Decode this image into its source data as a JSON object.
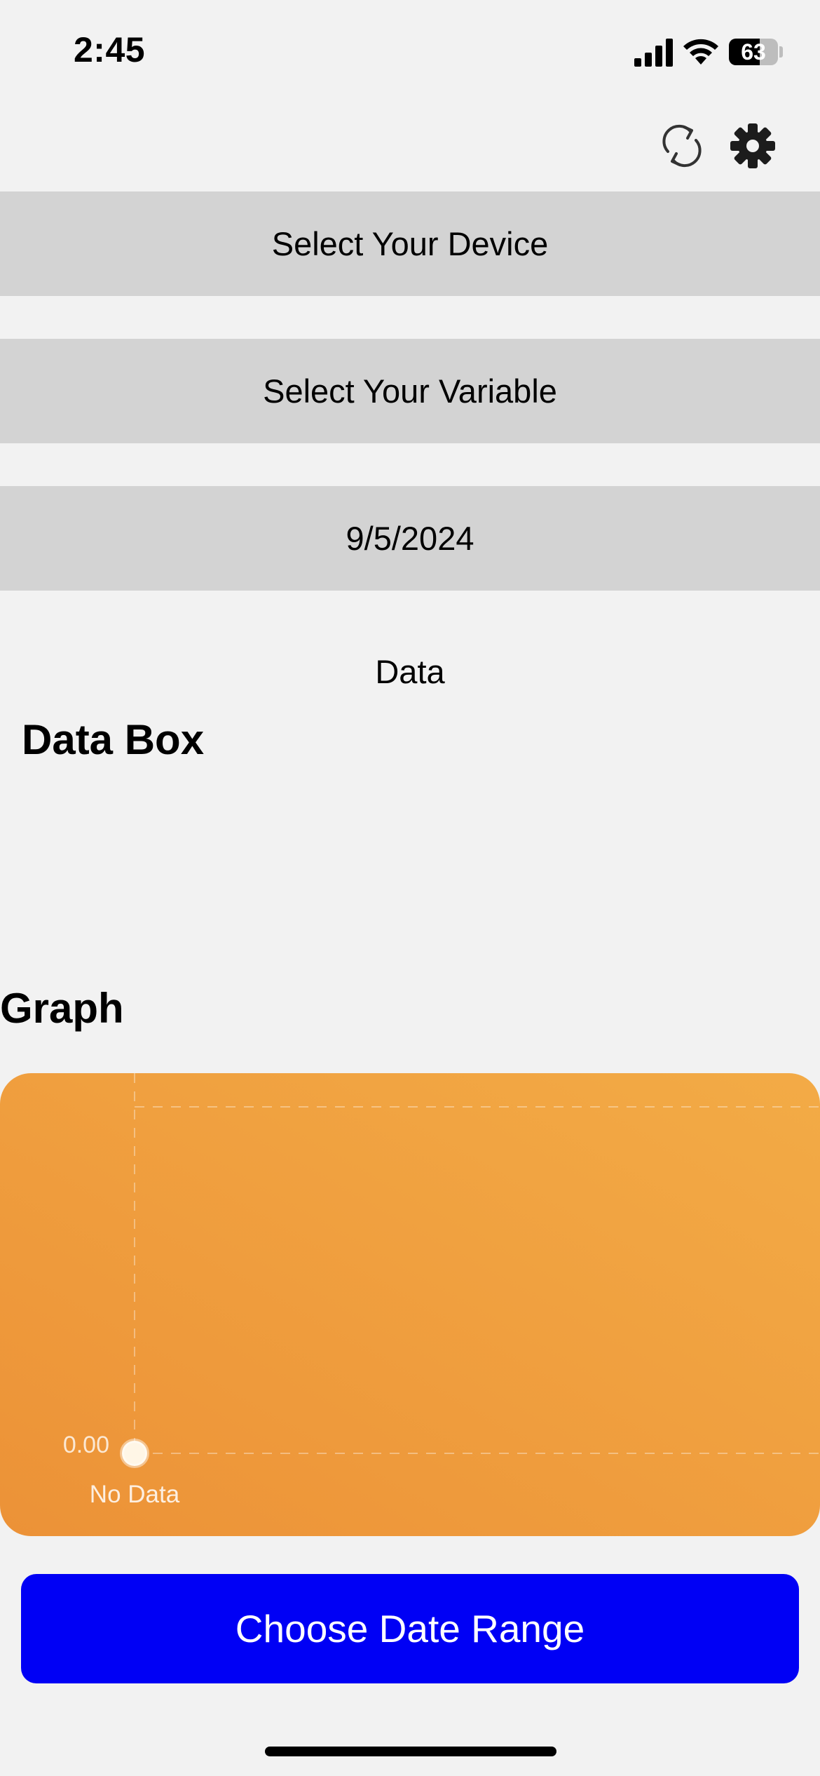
{
  "status_bar": {
    "time": "2:45",
    "battery_level": "63",
    "battery_fraction": 0.63
  },
  "toolbar": {
    "refresh_icon": "refresh-icon",
    "settings_icon": "gear-icon"
  },
  "selectors": {
    "device": "Select Your Device",
    "variable": "Select Your Variable",
    "date": "9/5/2024"
  },
  "data_section": {
    "label": "Data",
    "box_title": "Data Box"
  },
  "graph_section": {
    "title": "Graph"
  },
  "chart_data": {
    "type": "line",
    "categories": [
      "No Data"
    ],
    "values": [
      0
    ],
    "y_tick_labels": [
      "0.00"
    ],
    "grid": true,
    "background": [
      "#ec9237",
      "#f3ab46"
    ],
    "point_color": "#fff6e6"
  },
  "actions": {
    "choose_range": "Choose Date Range"
  },
  "colors": {
    "background": "#f2f2f2",
    "selector_bg": "#d3d3d3",
    "primary_button": "#0000f5"
  }
}
